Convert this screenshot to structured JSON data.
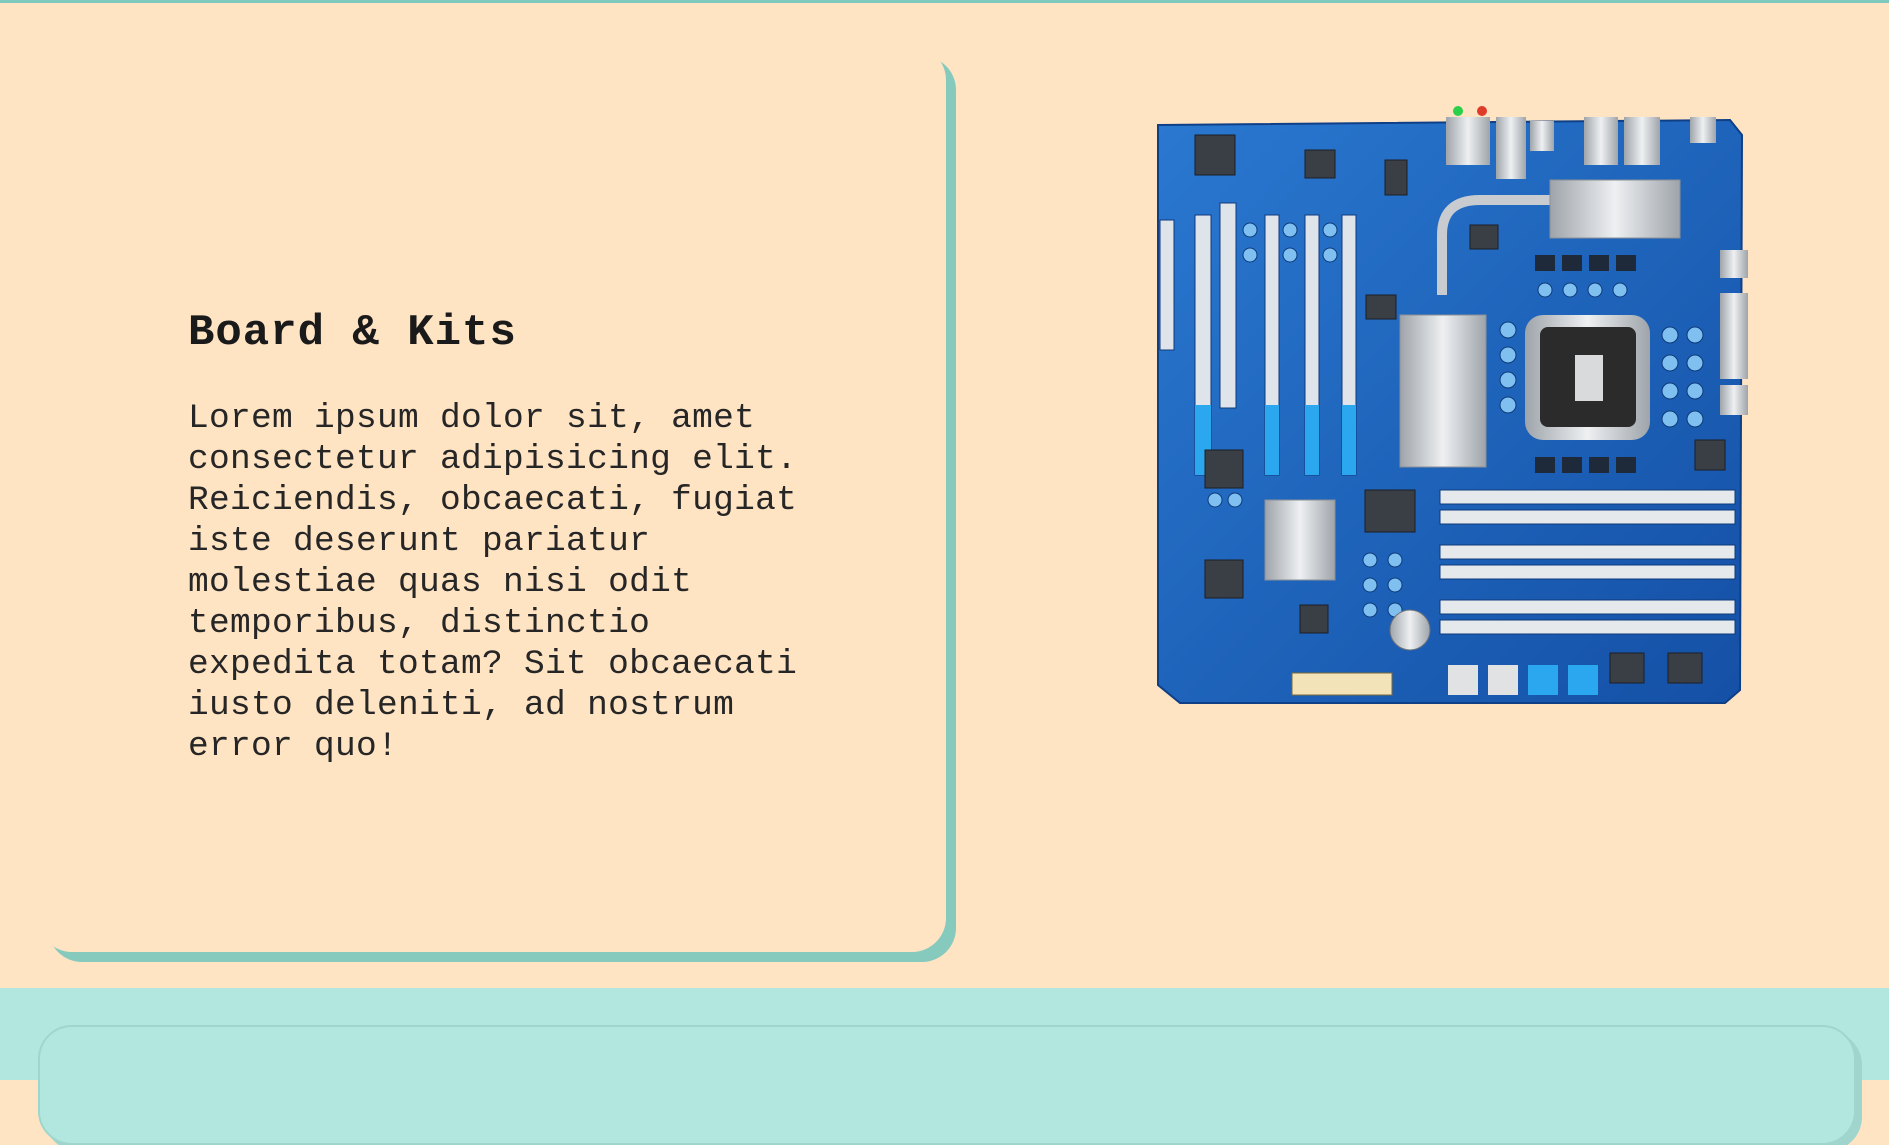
{
  "feature_card": {
    "title": "Board & Kits",
    "body": "Lorem ipsum dolor sit, amet consectetur adipisicing elit. Reiciendis, obcaecati, fugiat iste deserunt pariatur molestiae quas nisi odit temporibus, distinctio expedita totam? Sit obcaecati iusto deleniti, ad nostrum error quo!"
  },
  "image": {
    "icon": "motherboard-illustration"
  },
  "colors": {
    "page_background": "#ffe4c4",
    "accent": "#86c9bd",
    "next_section_background": "#b2e7df",
    "board_blue": "#1b5fb8"
  }
}
